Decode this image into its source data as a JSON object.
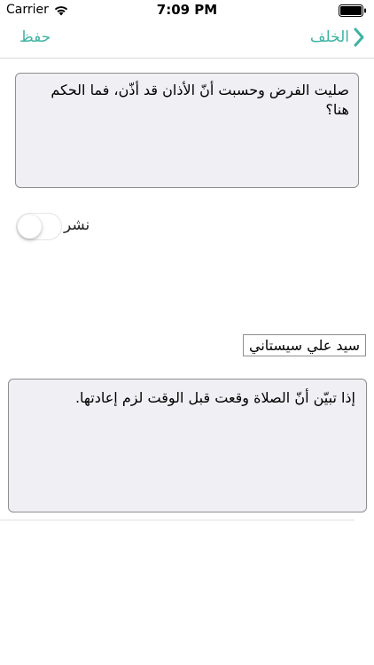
{
  "status_bar": {
    "carrier": "Carrier",
    "time": "7:09 PM"
  },
  "nav": {
    "save_label": "حفظ",
    "back_label": "الخلف"
  },
  "question": {
    "text": "صليت الفرض وحسبت أنّ الأذان قد أذّن، فما الحكم هنا؟"
  },
  "publish": {
    "label": "نشر",
    "toggle_on": false
  },
  "author": {
    "value": "سيد علي سيستاني"
  },
  "answer": {
    "text": "إذا تبيّن أنّ الصلاة وقعت قبل الوقت لزم إعادتها."
  },
  "colors": {
    "accent": "#3cb3a2",
    "field_background": "#efeff4"
  }
}
